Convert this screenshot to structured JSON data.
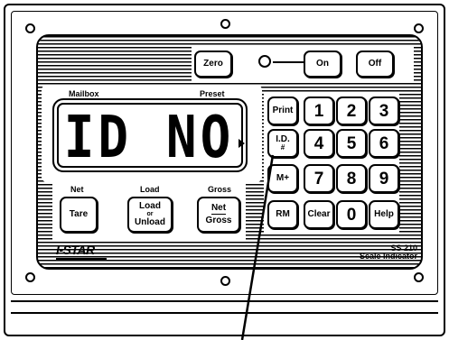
{
  "header_buttons": {
    "zero": "Zero",
    "on": "On",
    "off": "Off"
  },
  "display": {
    "label_left": "Mailbox",
    "label_right": "Preset",
    "readout": "ID NO"
  },
  "bottom_buttons": {
    "tare_label": "Net",
    "tare": "Tare",
    "load_label": "Load",
    "load_line1": "Load",
    "load_line2": "or",
    "load_line3": "Unload",
    "netgross_label": "Gross",
    "netgross_line1": "Net",
    "netgross_line2": "Gross"
  },
  "keypad": {
    "print": "Print",
    "k1": "1",
    "k2": "2",
    "k3": "3",
    "id_line1": "I.D.",
    "id_line2": "#",
    "k4": "4",
    "k5": "5",
    "k6": "6",
    "mplus": "M+",
    "k7": "7",
    "k8": "8",
    "k9": "9",
    "rm": "RM",
    "clear": "Clear",
    "k0": "0",
    "help": "Help"
  },
  "branding": {
    "brand": "I-STAR",
    "model_line1": "SS 210",
    "model_line2": "Scale Indicator"
  }
}
